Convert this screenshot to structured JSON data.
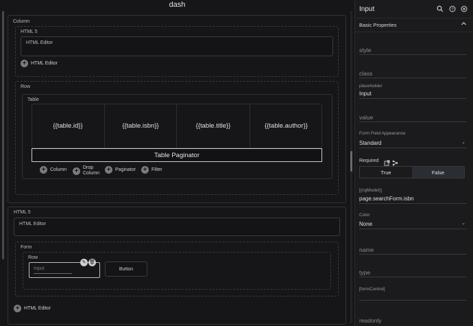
{
  "canvas": {
    "title": "dash",
    "column": {
      "label": "Column",
      "html5": {
        "label": "HTML 5",
        "editor_text": "HTML Editor",
        "add_label": "HTML Editor"
      },
      "row": {
        "label": "Row",
        "table": {
          "label": "Table",
          "columns": [
            "{{table.id}}",
            "{{table.isbn}}",
            "{{table.title}}",
            "{{table.author}}"
          ],
          "paginator": "Table Paginator",
          "actions": [
            "Column",
            "Drop Column",
            "Paginator",
            "Filter"
          ]
        }
      }
    },
    "html5_2": {
      "label": "HTML 5",
      "editor_text": "HTML Editor",
      "form": {
        "label": "Form",
        "row": {
          "label": "Row",
          "input_placeholder": "Input",
          "button_label": "Button"
        }
      },
      "add_label": "HTML Editor"
    }
  },
  "panel": {
    "title": "Input",
    "section": "Basic Properties",
    "props": {
      "style": "style",
      "class": "class",
      "placeholder_label": "placeholder",
      "placeholder_value": "Input",
      "value": "value",
      "appearance_label": "Form Field Appearance",
      "appearance_value": "Standard",
      "required_label": "Required",
      "toggle_true": "True",
      "toggle_false": "False",
      "ngmodel_label": "[(ngModel)]",
      "ngmodel_value": "page.searchForm.isbn",
      "color_label": "Color",
      "color_value": "None",
      "name": "name",
      "type": "type",
      "formcontrol_label": "[formControl]",
      "readonly": "readonly"
    }
  },
  "icons": {
    "search": "search-icon",
    "help": "help-icon",
    "close": "close-icon",
    "collapse": "chevron-up-icon",
    "open_external": "open-external-icon",
    "binding": "binding-icon"
  },
  "colors": {
    "background": "#18181a",
    "toggle_selected": "#2a2d33"
  }
}
